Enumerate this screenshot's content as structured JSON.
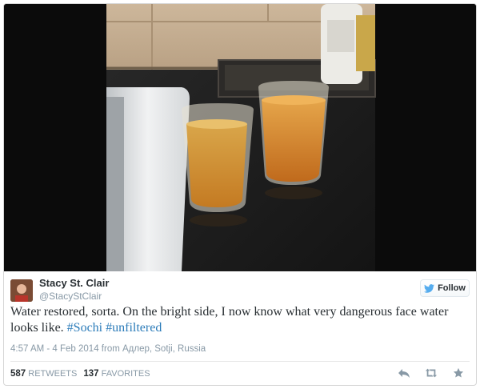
{
  "tweet": {
    "author_name": "Stacy St. Clair",
    "author_handle": "@StacyStClair",
    "follow_label": "Follow",
    "text_plain": "Water restored, sorta. On the bright side, I now know what very dangerous face water looks like. ",
    "hashtags": [
      "#Sochi",
      "#unfiltered"
    ],
    "timestamp": "4:57 AM - 4 Feb 2014 from Адлер, Sotji, Russia",
    "retweets_count": "587",
    "retweets_label": "RETWEETS",
    "favorites_count": "137",
    "favorites_label": "FAVORITES"
  },
  "icons": {
    "follow": "twitter-bird-icon",
    "reply": "reply-icon",
    "retweet": "retweet-icon",
    "favorite": "star-icon"
  },
  "colors": {
    "link": "#2b7bb9",
    "follow_bird": "#55acee",
    "muted": "#8899a6"
  }
}
